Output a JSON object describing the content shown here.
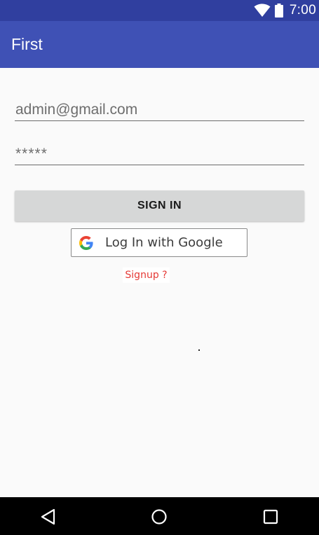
{
  "status_bar": {
    "time": "7:00"
  },
  "app_bar": {
    "title": "First"
  },
  "form": {
    "email_value": "admin@gmail.com",
    "password_value": "*****",
    "sign_in_label": "SIGN IN",
    "google_label": "Log In with Google",
    "signup_label": "Signup ?"
  },
  "colors": {
    "status_bar": "#303f9f",
    "app_bar": "#3f51b5",
    "signup_text": "#e53935"
  },
  "icons": {
    "status": [
      "wifi-icon",
      "battery-icon"
    ],
    "google": "google-g-icon",
    "nav": [
      "back-icon",
      "home-icon",
      "recents-icon"
    ]
  }
}
